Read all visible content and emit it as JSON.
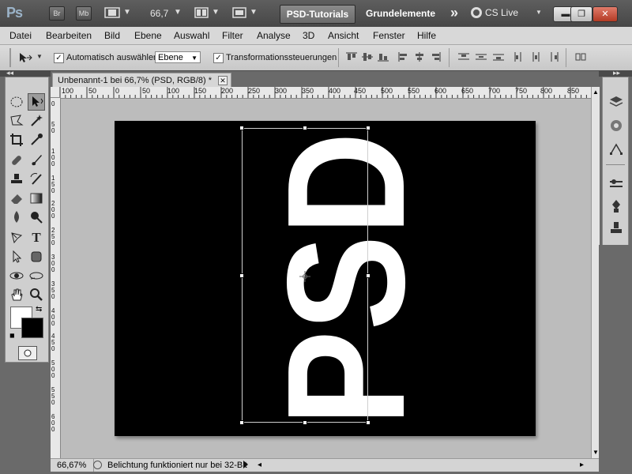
{
  "app": {
    "logo": "Ps",
    "bridge_label": "Br",
    "minibridge_label": "Mb",
    "zoom": "66,7",
    "workspaces": [
      "PSD-Tutorials",
      "Grundelemente"
    ],
    "more_label": "»",
    "cslive_label": "CS Live"
  },
  "menu": [
    "Datei",
    "Bearbeiten",
    "Bild",
    "Ebene",
    "Auswahl",
    "Filter",
    "Analyse",
    "3D",
    "Ansicht",
    "Fenster",
    "Hilfe"
  ],
  "options": {
    "auto_select_label": "Automatisch auswählen:",
    "auto_select_checked": "✓",
    "target_value": "Ebene",
    "transform_label": "Transformationssteuerungen",
    "transform_checked": "✓"
  },
  "document": {
    "tab_title": "Unbenannt-1 bei 66,7% (PSD, RGB/8) *",
    "close_label": "✕",
    "canvas_text": "PSD",
    "canvas_color": "#000000",
    "text_color": "#ffffff"
  },
  "ruler_h": [
    "100",
    "50",
    "0",
    "50",
    "100",
    "150",
    "200",
    "250",
    "300",
    "350",
    "400",
    "450",
    "500",
    "550",
    "600",
    "650",
    "700",
    "750",
    "800",
    "850"
  ],
  "ruler_v": [
    "0",
    "5 0",
    "1 0 0",
    "1 5 0",
    "2 0 0",
    "2 5 0",
    "3 0 0",
    "3 5 0",
    "4 0 0",
    "4 5 0",
    "5 0 0",
    "5 5 0",
    "6 0 0"
  ],
  "status": {
    "zoom": "66,67%",
    "message": "Belichtung funktioniert nur bei 32-Bit"
  },
  "colors": {
    "foreground": "#ffffff",
    "background": "#000000"
  }
}
